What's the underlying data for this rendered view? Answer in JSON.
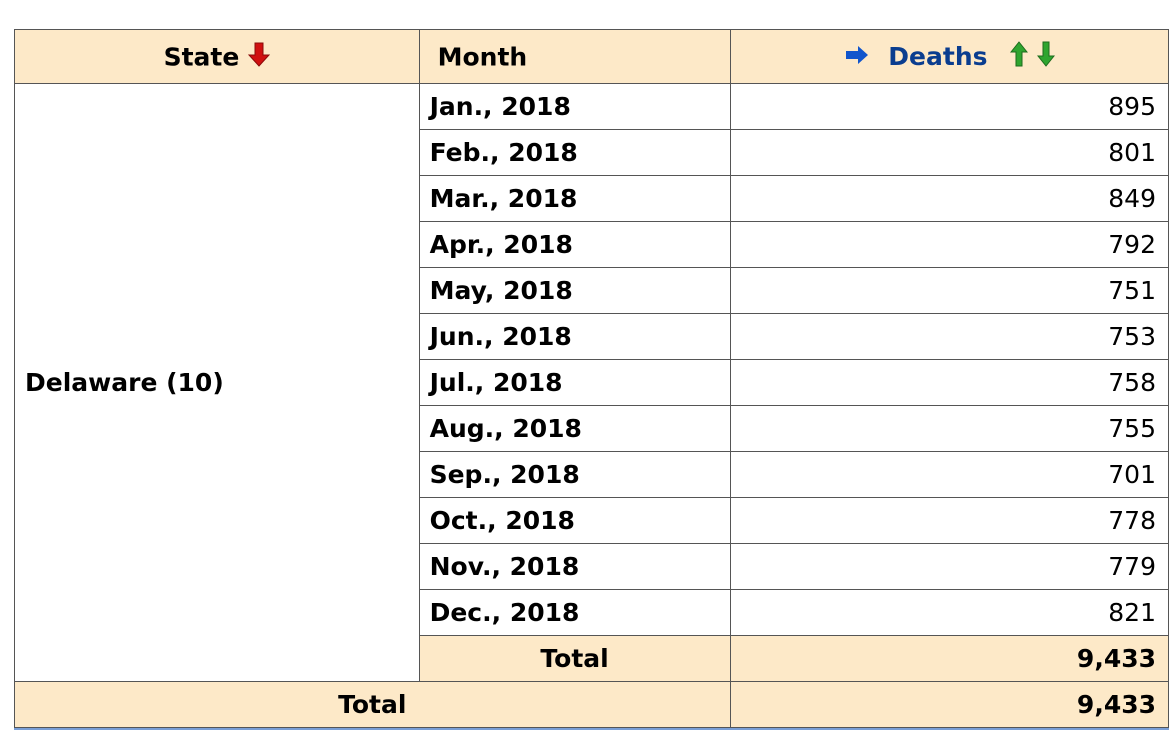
{
  "header": {
    "state_label": "State",
    "month_label": "Month",
    "deaths_label": "Deaths",
    "colors": {
      "sort_desc": "#d01010",
      "sort_up": "#2fa52f",
      "sort_down": "#2fa52f",
      "measure": "#1155cc"
    }
  },
  "group": {
    "state": "Delaware (10)",
    "rows": [
      {
        "month": "Jan., 2018",
        "deaths": "895"
      },
      {
        "month": "Feb., 2018",
        "deaths": "801"
      },
      {
        "month": "Mar., 2018",
        "deaths": "849"
      },
      {
        "month": "Apr., 2018",
        "deaths": "792"
      },
      {
        "month": "May, 2018",
        "deaths": "751"
      },
      {
        "month": "Jun., 2018",
        "deaths": "753"
      },
      {
        "month": "Jul., 2018",
        "deaths": "758"
      },
      {
        "month": "Aug., 2018",
        "deaths": "755"
      },
      {
        "month": "Sep., 2018",
        "deaths": "701"
      },
      {
        "month": "Oct., 2018",
        "deaths": "778"
      },
      {
        "month": "Nov., 2018",
        "deaths": "779"
      },
      {
        "month": "Dec., 2018",
        "deaths": "821"
      }
    ],
    "subtotal_label": "Total",
    "subtotal_value": "9,433"
  },
  "grand_total": {
    "label": "Total",
    "value": "9,433"
  }
}
